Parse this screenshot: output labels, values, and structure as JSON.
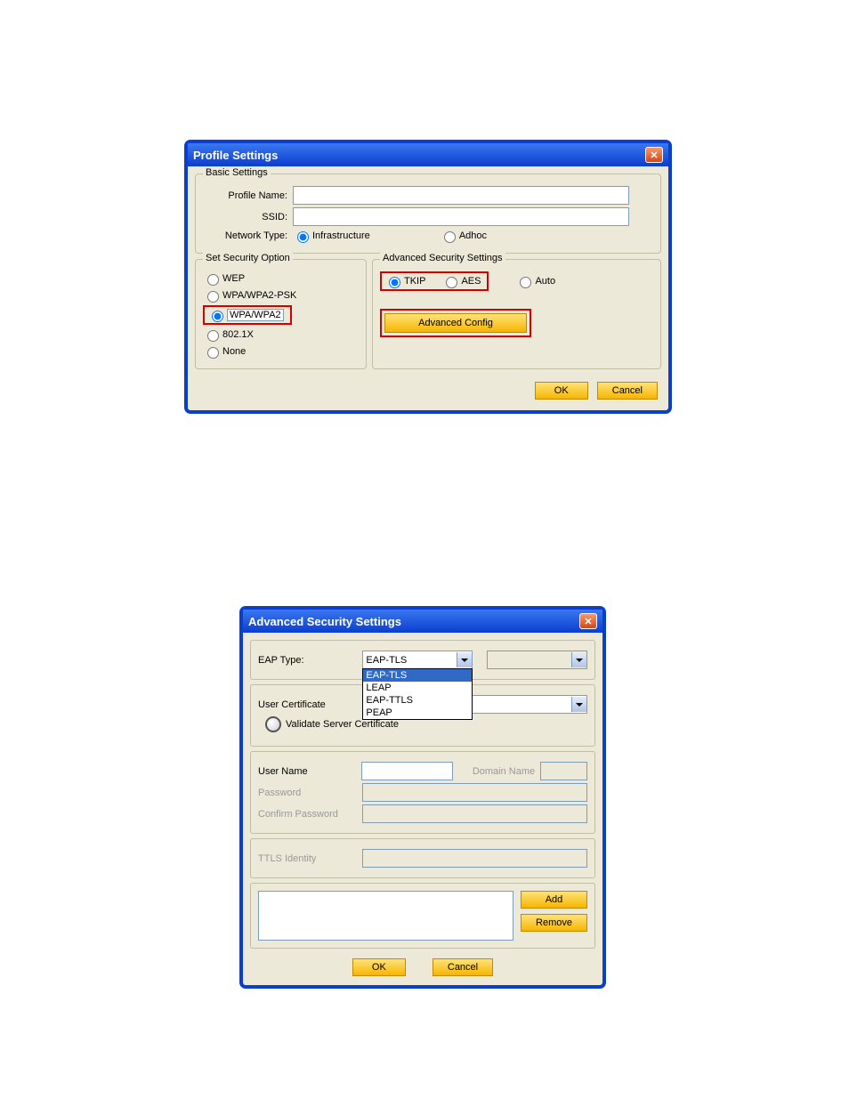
{
  "dialog1": {
    "title": "Profile Settings",
    "basic": {
      "legend": "Basic Settings",
      "profile_name_label": "Profile Name:",
      "profile_name_value": "",
      "ssid_label": "SSID:",
      "ssid_value": "",
      "network_type_label": "Network Type:",
      "infrastructure": "Infrastructure",
      "adhoc": "Adhoc"
    },
    "security": {
      "legend": "Set Security Option",
      "wep": "WEP",
      "wpapsk": "WPA/WPA2-PSK",
      "wpa": "WPA/WPA2",
      "dot1x": "802.1X",
      "none": "None"
    },
    "advanced": {
      "legend": "Advanced Security Settings",
      "tkip": "TKIP",
      "aes": "AES",
      "auto": "Auto",
      "adv_config": "Advanced Config"
    },
    "buttons": {
      "ok": "OK",
      "cancel": "Cancel"
    }
  },
  "dialog2": {
    "title": "Advanced Security Settings",
    "eap": {
      "label": "EAP Type:",
      "selected": "EAP-TLS",
      "options": [
        "EAP-TLS",
        "LEAP",
        "EAP-TTLS",
        "PEAP"
      ]
    },
    "cert": {
      "label": "User Certificate",
      "validate": "Validate Server Certificate"
    },
    "user": {
      "username_label": "User Name",
      "username_value": "",
      "domain_label": "Domain Name",
      "domain_value": "",
      "password_label": "Password",
      "confirm_label": "Confirm Password"
    },
    "ttls": {
      "label": "TTLS Identity"
    },
    "buttons": {
      "add": "Add",
      "remove": "Remove",
      "ok": "OK",
      "cancel": "Cancel"
    }
  }
}
